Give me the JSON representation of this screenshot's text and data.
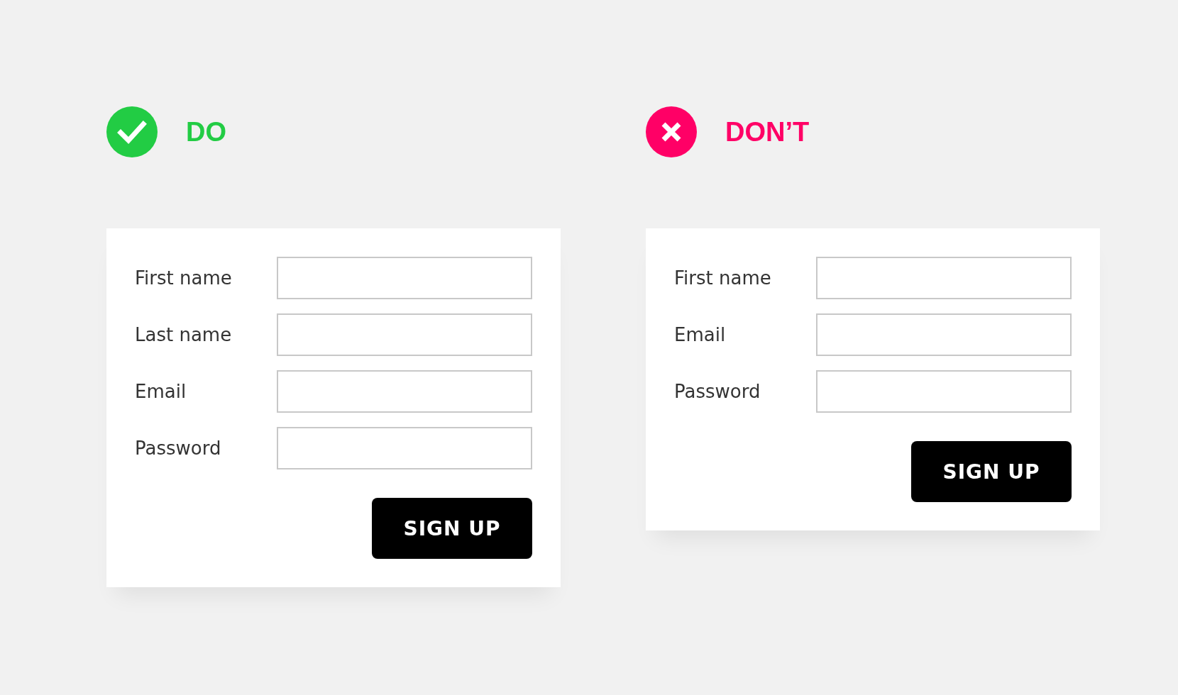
{
  "panels": [
    {
      "kind": "do",
      "heading": "DO",
      "fields": [
        {
          "label": "First name"
        },
        {
          "label": "Last name"
        },
        {
          "label": "Email"
        },
        {
          "label": "Password"
        }
      ],
      "button": "SIGN UP"
    },
    {
      "kind": "dont",
      "heading": "DON’T",
      "fields": [
        {
          "label": "First name"
        },
        {
          "label": "Email"
        },
        {
          "label": "Password"
        }
      ],
      "button": "SIGN UP"
    }
  ]
}
